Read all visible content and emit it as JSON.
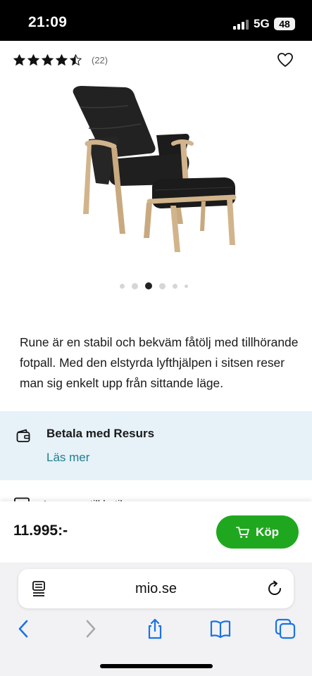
{
  "status_bar": {
    "time": "21:09",
    "network": "5G",
    "battery": "48"
  },
  "product": {
    "rating": 4.5,
    "rating_max": 5,
    "review_count": "(22)",
    "description": "Rune är en stabil och bekväm fåtölj med tillhörande fotpall. Med den elstyrda lyfthjälpen i sitsen reser man sig enkelt upp från sittande läge.",
    "image_icon": "recliner-chair-with-footstool",
    "carousel": {
      "total": 6,
      "active_index": 2
    }
  },
  "payment": {
    "title": "Betala med Resurs",
    "link": "Läs mer",
    "icon": "wallet-icon"
  },
  "next_section_peek": "Leverans till butik",
  "buy_bar": {
    "price": "11.995:-",
    "button_label": "Köp"
  },
  "browser": {
    "url": "mio.se"
  },
  "colors": {
    "buy_green": "#1fa81f",
    "link_teal": "#1e7e8e",
    "payment_bg": "#e6f1f8",
    "toolbar_blue": "#1a73e8"
  }
}
